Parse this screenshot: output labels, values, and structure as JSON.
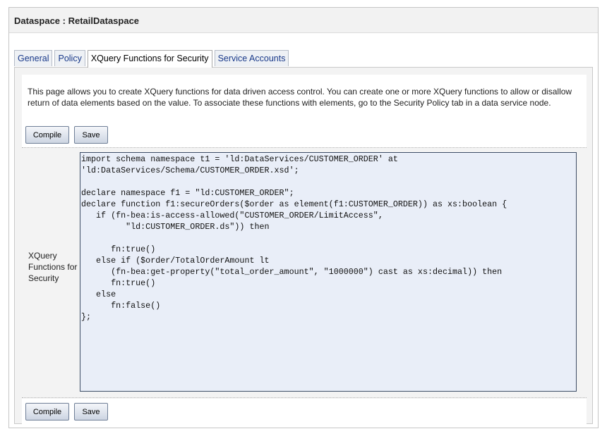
{
  "header": {
    "title": "Dataspace : RetailDataspace"
  },
  "tabs": [
    {
      "label": "General",
      "active": false
    },
    {
      "label": "Policy",
      "active": false
    },
    {
      "label": "XQuery Functions for Security",
      "active": true
    },
    {
      "label": "Service Accounts",
      "active": false
    }
  ],
  "intro": {
    "text": "This page allows you to create XQuery functions for data driven access control. You can create one or more XQuery functions to allow or disallow return of data elements based on the value. To associate these functions with elements, go to the Security Policy tab in a data service node."
  },
  "buttons": {
    "compile": "Compile",
    "save": "Save"
  },
  "editor": {
    "label": "XQuery Functions for Security",
    "code": "import schema namespace t1 = 'ld:DataServices/CUSTOMER_ORDER' at\n'ld:DataServices/Schema/CUSTOMER_ORDER.xsd';\n\ndeclare namespace f1 = \"ld:CUSTOMER_ORDER\";\ndeclare function f1:secureOrders($order as element(f1:CUSTOMER_ORDER)) as xs:boolean {\n   if (fn-bea:is-access-allowed(\"CUSTOMER_ORDER/LimitAccess\",\n         \"ld:CUSTOMER_ORDER.ds\")) then\n\n      fn:true()\n   else if ($order/TotalOrderAmount lt\n      (fn-bea:get-property(\"total_order_amount\", \"1000000\") cast as xs:decimal)) then\n      fn:true()\n   else\n      fn:false()\n};"
  }
}
